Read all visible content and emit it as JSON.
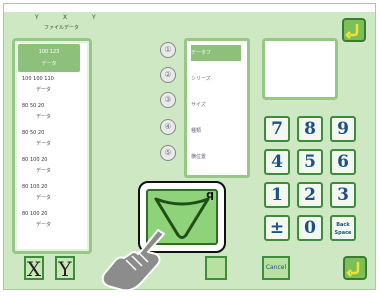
{
  "header": {
    "labels": [
      "Y",
      "X",
      "Y"
    ],
    "sublabel": "ファイルデータ"
  },
  "list": {
    "selected": {
      "line1": "100  123",
      "line2": "データ"
    },
    "items": [
      {
        "a": "100  100  110",
        "b": "データ"
      },
      {
        "a": "80   50   20",
        "b": "データ"
      },
      {
        "a": "80   50   20",
        "b": "データ"
      },
      {
        "a": "80   100  20",
        "b": "データ"
      },
      {
        "a": "80   100  20",
        "b": "データ"
      },
      {
        "a": "80   100  20",
        "b": "データ"
      }
    ]
  },
  "side_buttons": [
    "①",
    "②",
    "③",
    "④",
    "⑤"
  ],
  "options": [
    {
      "label": "データフ",
      "selected": true
    },
    {
      "label": "シリーズ",
      "selected": false
    },
    {
      "label": "サイズ",
      "selected": false
    },
    {
      "label": "種類",
      "selected": false
    },
    {
      "label": "横位置",
      "selected": false
    }
  ],
  "keypad": {
    "row1": [
      "7",
      "8",
      "9"
    ],
    "row2": [
      "4",
      "5",
      "6"
    ],
    "row3": [
      "1",
      "2",
      "3"
    ],
    "row4": [
      "±",
      "0"
    ],
    "back_space": "Back Space"
  },
  "bottom": {
    "x": "X",
    "y": "Y",
    "cancel": "Cancel"
  },
  "zoom": {
    "letter": "q"
  },
  "colors": {
    "panel": "#cde8c2",
    "accent": "#8dc07a",
    "key_text": "#1e4f8a"
  }
}
